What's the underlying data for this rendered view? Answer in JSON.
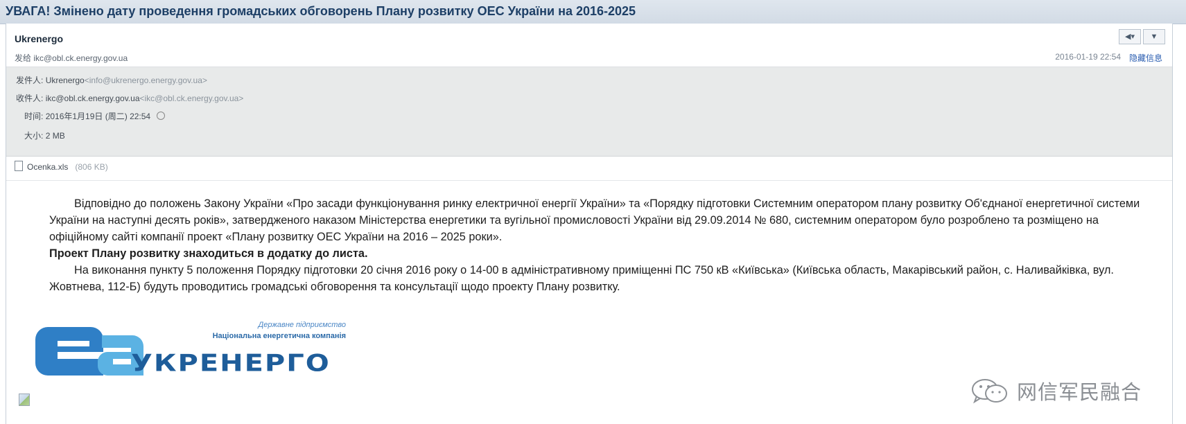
{
  "subject": "УВАГА! Змінено дату проведення громадських обговорень Плану розвитку ОЕС України на 2016-2025",
  "header": {
    "sender_name": "Ukrenergo",
    "recipient_line": "发给 ikc@obl.ck.energy.gov.ua",
    "date": "2016-01-19 22:54",
    "hide_details": "隐藏信息",
    "reply_icon": "reply-icon",
    "more_icon": "chevron-down-icon"
  },
  "details": {
    "from_label": "发件人:",
    "from_name": "Ukrenergo",
    "from_email": "<info@ukrenergo.energy.gov.ua>",
    "to_label": "收件人:",
    "to_name": "ikc@obl.ck.energy.gov.ua",
    "to_email": "<ikc@obl.ck.energy.gov.ua>",
    "time_label": "时间:",
    "time_value": "2016年1月19日 (周二) 22:54",
    "size_label": "大小:",
    "size_value": "2 MB"
  },
  "attachment": {
    "name": "Ocenka.xls",
    "size": "(806 KB)"
  },
  "body": {
    "paragraph1": "Відповідно до положень Закону України «Про засади функціонування ринку електричної енергії України» та «Порядку підготовки Системним оператором плану розвитку Об'єднаної енергетичної системи України на наступні десять років», затвердженого наказом Міністерства енергетики та вугільної промисловості України від 29.09.2014 № 680, системним оператором було розроблено та розміщено на офіційному сайті компанії проект «Плану розвитку ОЕС України на 2016 – 2025 роки».",
    "paragraph2": "Проект Плану розвитку знаходиться в додатку до листа.",
    "paragraph3": "На виконання пункту 5 положення Порядку підготовки 20 січня 2016 року о 14-00 в адміністративному приміщенні ПС 750 кВ «Київська» (Київська область, Макарівський район, с. Наливайківка, вул. Жовтнева, 112-Б) будуть проводитись громадські обговорення та консультації щодо проекту Плану розвитку."
  },
  "logo": {
    "line1": "Державне підприємство",
    "line2": "Національна енергетична компанія",
    "wordmark": "УКРЕНЕРГО",
    "colors": {
      "blue": "#2f7fc6",
      "light_blue": "#5bb2e3",
      "dark": "#1e5d9a"
    }
  },
  "watermark": {
    "text": "网信军民融合",
    "icon": "wechat-icon"
  },
  "broken_image_icon": "broken-image-icon"
}
